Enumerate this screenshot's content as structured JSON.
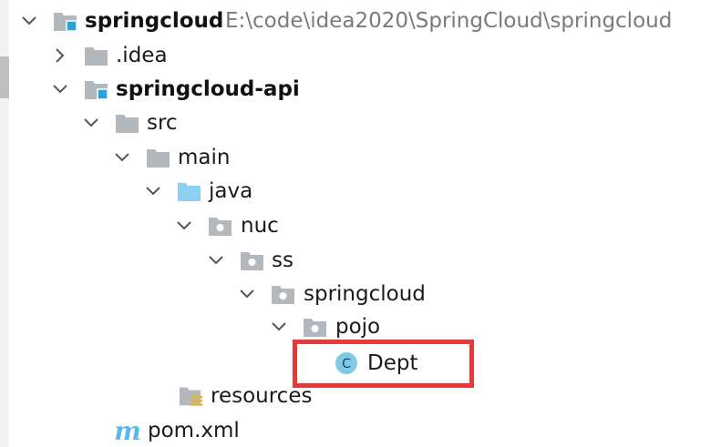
{
  "tree": {
    "root": {
      "label": "springcloud",
      "path": "E:\\code\\idea2020\\SpringCloud\\springcloud"
    },
    "idea": {
      "label": ".idea"
    },
    "api": {
      "label": "springcloud-api"
    },
    "src": {
      "label": "src"
    },
    "main": {
      "label": "main"
    },
    "java": {
      "label": "java"
    },
    "nuc": {
      "label": "nuc"
    },
    "ss": {
      "label": "ss"
    },
    "springcloud_pkg": {
      "label": "springcloud"
    },
    "pojo": {
      "label": "pojo"
    },
    "dept": {
      "label": "Dept",
      "badge": "C"
    },
    "resources": {
      "label": "resources"
    },
    "pom": {
      "label": "pom.xml",
      "badge": "m"
    }
  },
  "colors": {
    "folder_gray": "#b2b8bd",
    "source_root_blue": "#8ed0ef",
    "module_square": "#2aa2d8",
    "class_circle": "#7ecbe8",
    "highlight": "#e8393a",
    "maven_m": "#5bb8e6"
  }
}
